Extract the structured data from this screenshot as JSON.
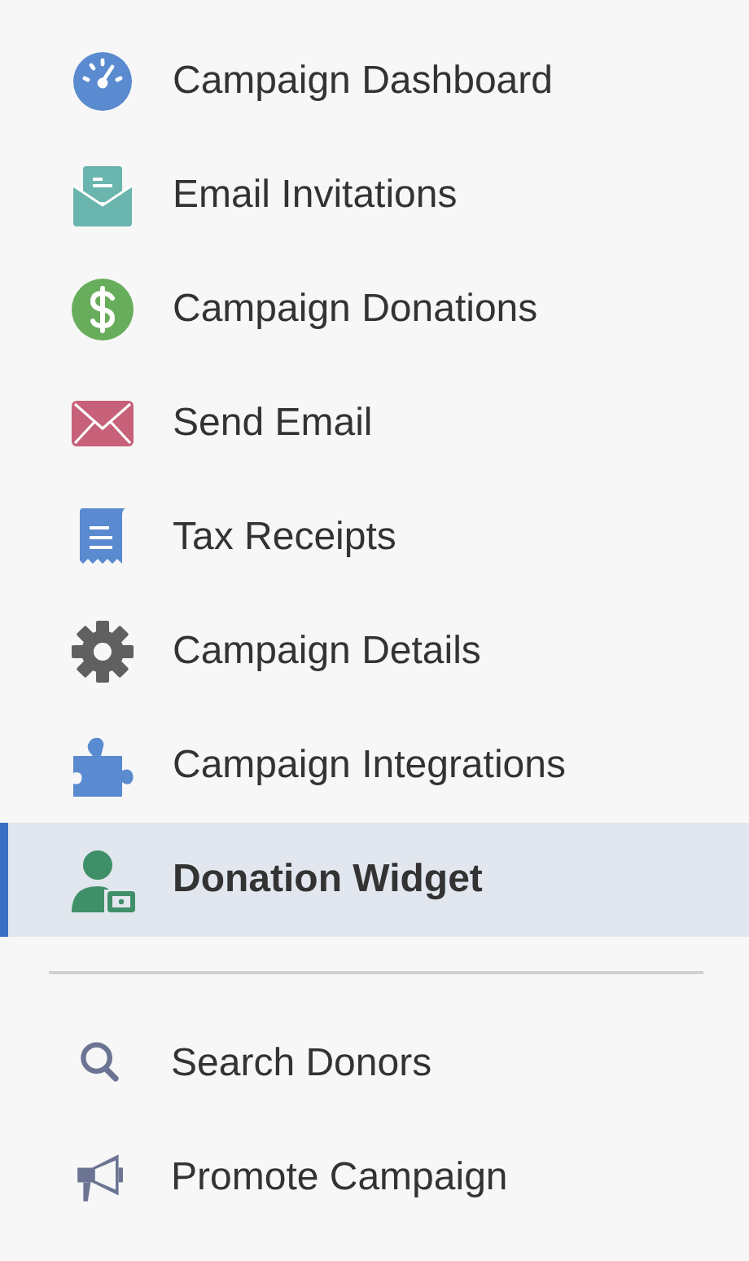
{
  "menu": {
    "items": [
      {
        "label": "Campaign Dashboard",
        "selected": false
      },
      {
        "label": "Email Invitations",
        "selected": false
      },
      {
        "label": "Campaign Donations",
        "selected": false
      },
      {
        "label": "Send Email",
        "selected": false
      },
      {
        "label": "Tax Receipts",
        "selected": false
      },
      {
        "label": "Campaign Details",
        "selected": false
      },
      {
        "label": "Campaign Integrations",
        "selected": false
      },
      {
        "label": "Donation Widget",
        "selected": true
      }
    ]
  },
  "tools": {
    "items": [
      {
        "label": "Search Donors"
      },
      {
        "label": "Promote Campaign"
      }
    ]
  }
}
